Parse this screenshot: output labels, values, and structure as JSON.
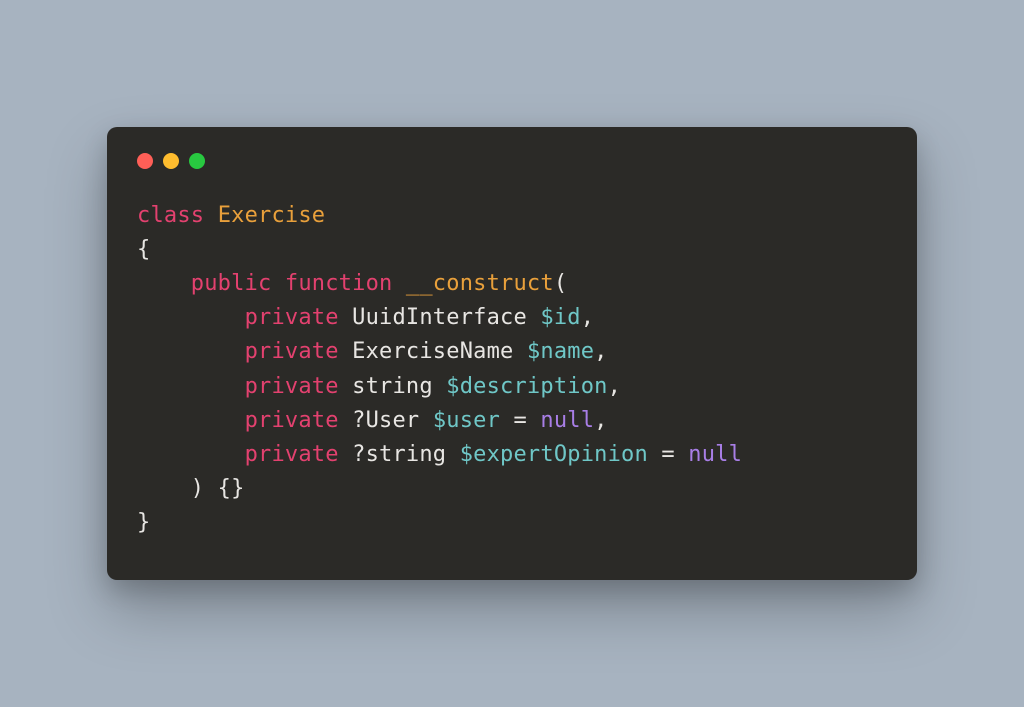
{
  "code": {
    "kw_class": "class",
    "cls_name": "Exercise",
    "brace_open": "{",
    "kw_public": "public",
    "kw_function": "function",
    "fn_name": "__construct",
    "paren_open": "(",
    "kw_private1": "private",
    "type1": "UuidInterface ",
    "var1": "$id",
    "comma1": ",",
    "kw_private2": "private",
    "type2": "ExerciseName ",
    "var2": "$name",
    "comma2": ",",
    "kw_private3": "private",
    "type3": "string ",
    "var3": "$description",
    "comma3": ",",
    "kw_private4": "private",
    "type4": "?User ",
    "var4": "$user",
    "eq4": " = ",
    "null4": "null",
    "comma4": ",",
    "kw_private5": "private",
    "type5": "?string ",
    "var5": "$expertOpinion",
    "eq5": " = ",
    "null5": "null",
    "close_paren_braces": ") {}",
    "brace_close": "}"
  }
}
